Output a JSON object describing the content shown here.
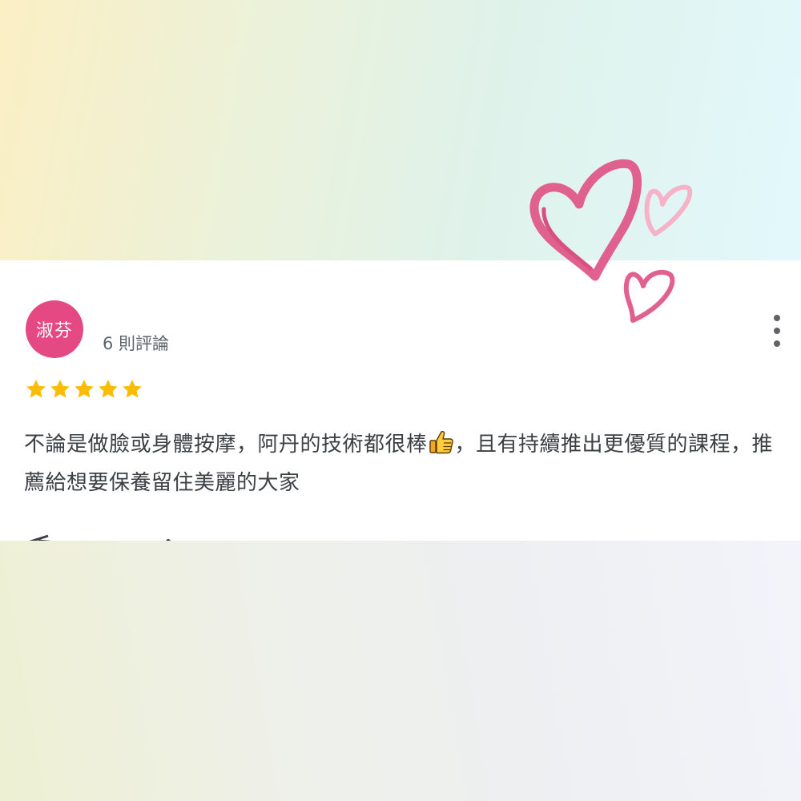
{
  "review": {
    "avatar_text": "淑芬",
    "reviewer_name": "",
    "review_count": "6 則評論",
    "text_before_icon": "不論是做臉或身體按摩，阿丹的技術都很棒",
    "text_after_icon": "，且有持續推出更優質的課程，推薦給想要保養留住美麗的大家"
  },
  "rating": {
    "value": 5,
    "max": 5
  },
  "icons": {
    "inline": "thumbs-up-icon",
    "menu": "more-vert-icon",
    "decoration": "hearts-icon"
  },
  "colors": {
    "avatar_bg": "#e44983",
    "star": "#fbbc04",
    "heart_dark": "#e0608e",
    "heart_light": "#f6b3c8"
  }
}
